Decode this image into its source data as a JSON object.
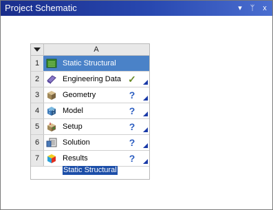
{
  "window": {
    "title": "Project Schematic",
    "buttons": {
      "pin": "▾",
      "autohide": "ᛘ",
      "close": "x"
    }
  },
  "system": {
    "column_header": "A",
    "label": "Static Structural",
    "rows": [
      {
        "num": "1",
        "label": "Static Structural",
        "icon": "analysis-system-icon",
        "status": ""
      },
      {
        "num": "2",
        "label": "Engineering Data",
        "icon": "engineering-data-icon",
        "status": "✓"
      },
      {
        "num": "3",
        "label": "Geometry",
        "icon": "geometry-icon",
        "status": "?"
      },
      {
        "num": "4",
        "label": "Model",
        "icon": "model-icon",
        "status": "?"
      },
      {
        "num": "5",
        "label": "Setup",
        "icon": "setup-icon",
        "status": "?"
      },
      {
        "num": "6",
        "label": "Solution",
        "icon": "solution-icon",
        "status": "?"
      },
      {
        "num": "7",
        "label": "Results",
        "icon": "results-icon",
        "status": "?"
      }
    ]
  },
  "colors": {
    "selected_row": "#4a82c8",
    "check": "#6a8a28",
    "question": "#2a5cc0",
    "label_highlight": "#1c4ea8"
  }
}
